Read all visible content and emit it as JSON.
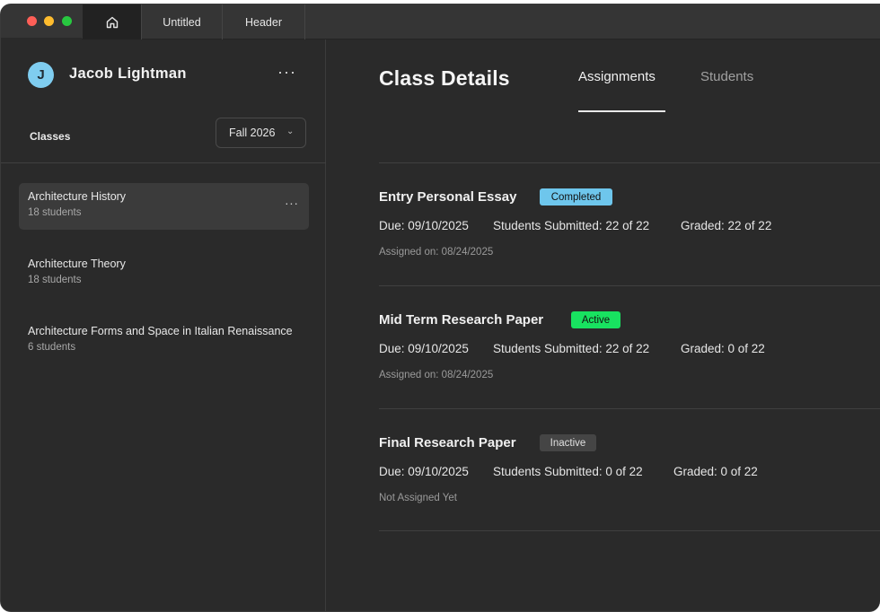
{
  "titlebar": {
    "home_icon": "home-icon",
    "tabs": [
      {
        "label": "Untitled"
      },
      {
        "label": "Header"
      }
    ]
  },
  "sidebar": {
    "user": {
      "initial": "J",
      "name": "Jacob Lightman"
    },
    "more_glyph": "···",
    "classes_label": "Classes",
    "term": "Fall 2026",
    "chevron_glyph": "⌄",
    "items": [
      {
        "name": "Architecture History",
        "count": "18 students",
        "more": "···"
      },
      {
        "name": "Architecture Theory",
        "count": "18 students"
      },
      {
        "name": "Architecture Forms and Space in Italian Renaissance",
        "count": "6 students"
      }
    ]
  },
  "main": {
    "title": "Class Details",
    "tabs": [
      {
        "label": "Assignments"
      },
      {
        "label": "Students"
      }
    ],
    "assignments": [
      {
        "title": "Entry Personal Essay",
        "status": "Completed",
        "due": "Due: 09/10/2025",
        "submitted": "Students Submitted: 22 of 22",
        "graded": "Graded: 22 of 22",
        "note": "Assigned on: 08/24/2025"
      },
      {
        "title": "Mid Term Research Paper",
        "status": "Active",
        "due": "Due: 09/10/2025",
        "submitted": "Students Submitted: 22 of 22",
        "graded": "Graded: 0 of 22",
        "note": "Assigned on: 08/24/2025"
      },
      {
        "title": "Final Research Paper",
        "status": "Inactive",
        "due": "Due: 09/10/2025",
        "submitted": "Students Submitted: 0 of 22",
        "graded": "Graded: 0 of 22",
        "note": "Not Assigned Yet"
      }
    ]
  },
  "colors": {
    "completed": "#6ec6ec",
    "active": "#18e260",
    "inactive": "#454545",
    "avatar": "#7fcdf0"
  }
}
